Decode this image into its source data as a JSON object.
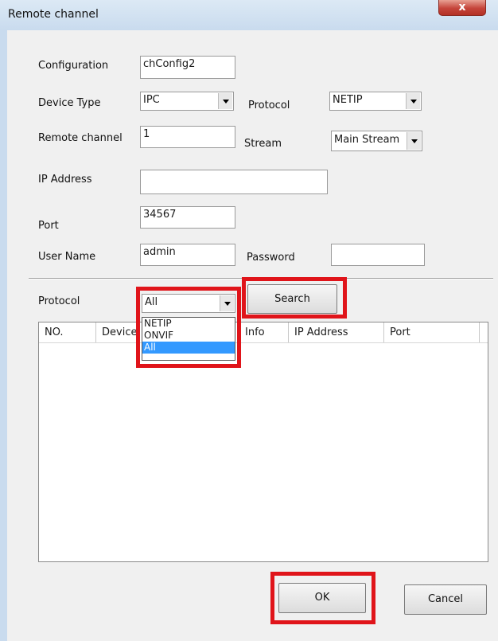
{
  "window": {
    "title": "Remote channel",
    "close_label": "x"
  },
  "form": {
    "configuration_label": "Configuration",
    "configuration_value": "chConfig2",
    "device_type_label": "Device Type",
    "device_type_value": "IPC",
    "protocol_label": "Protocol",
    "protocol_value": "NETIP",
    "remote_channel_label": "Remote channel",
    "remote_channel_value": "1",
    "stream_label": "Stream",
    "stream_value": "Main Stream",
    "ip_address_label": "IP Address",
    "ip_address_value": "",
    "port_label": "Port",
    "port_value": "34567",
    "user_name_label": "User Name",
    "user_name_value": "admin",
    "password_label": "Password",
    "password_value": ""
  },
  "search": {
    "protocol_label": "Protocol",
    "protocol_value": "All",
    "options": [
      "NETIP",
      "ONVIF",
      "All"
    ],
    "selected_option": "All",
    "search_button": "Search"
  },
  "table": {
    "columns": [
      "NO.",
      "Device",
      "Info",
      "IP Address",
      "Port"
    ]
  },
  "footer": {
    "ok_label": "OK",
    "cancel_label": "Cancel"
  },
  "highlight_color": "#e0141a"
}
